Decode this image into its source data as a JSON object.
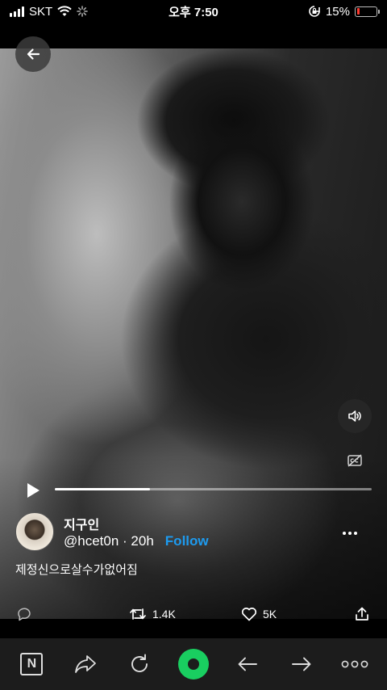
{
  "status_bar": {
    "carrier": "SKT",
    "time": "오후 7:50",
    "battery_percent": "15%",
    "battery_level": 0.15,
    "battery_color": "#ff3b30"
  },
  "video": {
    "progress": 0.3,
    "back_icon": "arrow-left-icon",
    "volume_icon": "speaker-icon",
    "captions_icon": "cc-icon"
  },
  "tweet": {
    "display_name": "지구인",
    "handle": "@hcet0n",
    "separator": " · ",
    "age": "20h",
    "follow_label": "Follow",
    "follow_color": "#1d9bf0",
    "text": "제정신으로살수가없어짐",
    "actions": {
      "retweets": "1.4K",
      "likes": "5K"
    }
  },
  "bottom_nav": {
    "items": [
      "naver-n-icon",
      "share-icon",
      "refresh-icon",
      "green-home-icon",
      "back-arrow-icon",
      "forward-arrow-icon",
      "more-dots-icon"
    ],
    "n_label": "N",
    "accent": "#19ce60"
  }
}
